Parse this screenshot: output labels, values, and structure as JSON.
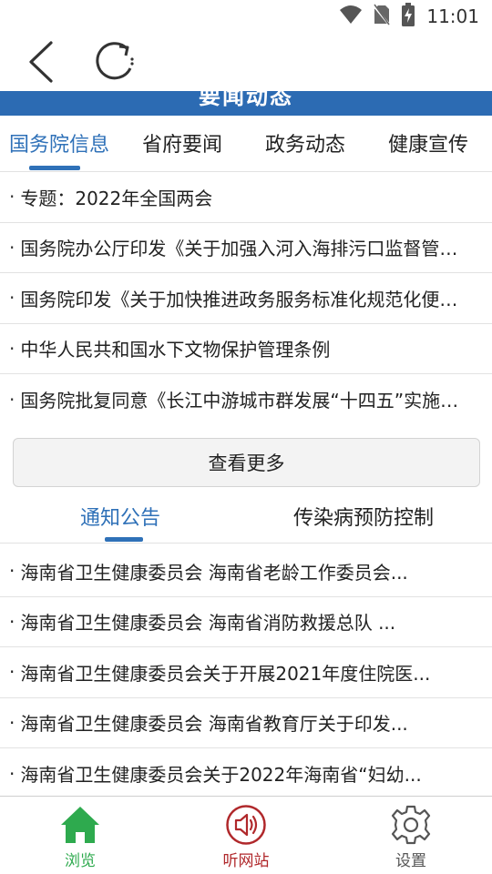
{
  "status_bar": {
    "time": "11:01"
  },
  "section_header": {
    "title": "要闻动态"
  },
  "tabs_top": [
    "国务院信息",
    "省府要闻",
    "政务动态",
    "健康宣传"
  ],
  "news_items": [
    "专题：2022年全国两会",
    "国务院办公厅印发《关于加强入河入海排污口监督管理工作的实施意见》",
    "国务院印发《关于加快推进政务服务标准化规范化便利化的指导意见》",
    "中华人民共和国水下文物保护管理条例",
    "国务院批复同意《长江中游城市群发展“十四五”实施方案》"
  ],
  "more_button": "查看更多",
  "tabs_notice": [
    "通知公告",
    "传染病预防控制"
  ],
  "notice_items": [
    "海南省卫生健康委员会 海南省老龄工作委员会...",
    "海南省卫生健康委员会 海南省消防救援总队 ...",
    "海南省卫生健康委员会关于开展2021年度住院医...",
    "海南省卫生健康委员会 海南省教育厅关于印发...",
    "海南省卫生健康委员会关于2022年海南省“妇幼..."
  ],
  "bottom_nav": {
    "browse": "浏览",
    "listen": "听网站",
    "settings": "设置"
  },
  "colors": {
    "accent_blue": "#2f71b8",
    "header_blue": "#2c6bb3",
    "browse_green": "#2eaa4e",
    "listen_red": "#b0282b",
    "settings_gray": "#555555"
  }
}
